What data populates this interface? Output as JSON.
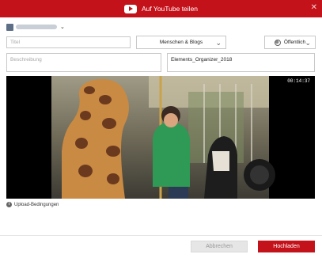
{
  "window": {
    "title": "Auf YouTube teilen",
    "close_glyph": "✕",
    "accent": "#c4121b"
  },
  "account": {
    "chevron": "⌄"
  },
  "form": {
    "title_placeholder": "Titel",
    "category_value": "Menschen & Blogs",
    "privacy_value": "Öffentlich",
    "description_placeholder": "Beschreibung",
    "tags_value": "Elements_Organizer_2018"
  },
  "video": {
    "duration": "00:14:37"
  },
  "upload_terms": {
    "label": "Upload-Bedingungen",
    "icon": "i"
  },
  "buttons": {
    "cancel": "Abbrechen",
    "upload": "Hochladen"
  }
}
